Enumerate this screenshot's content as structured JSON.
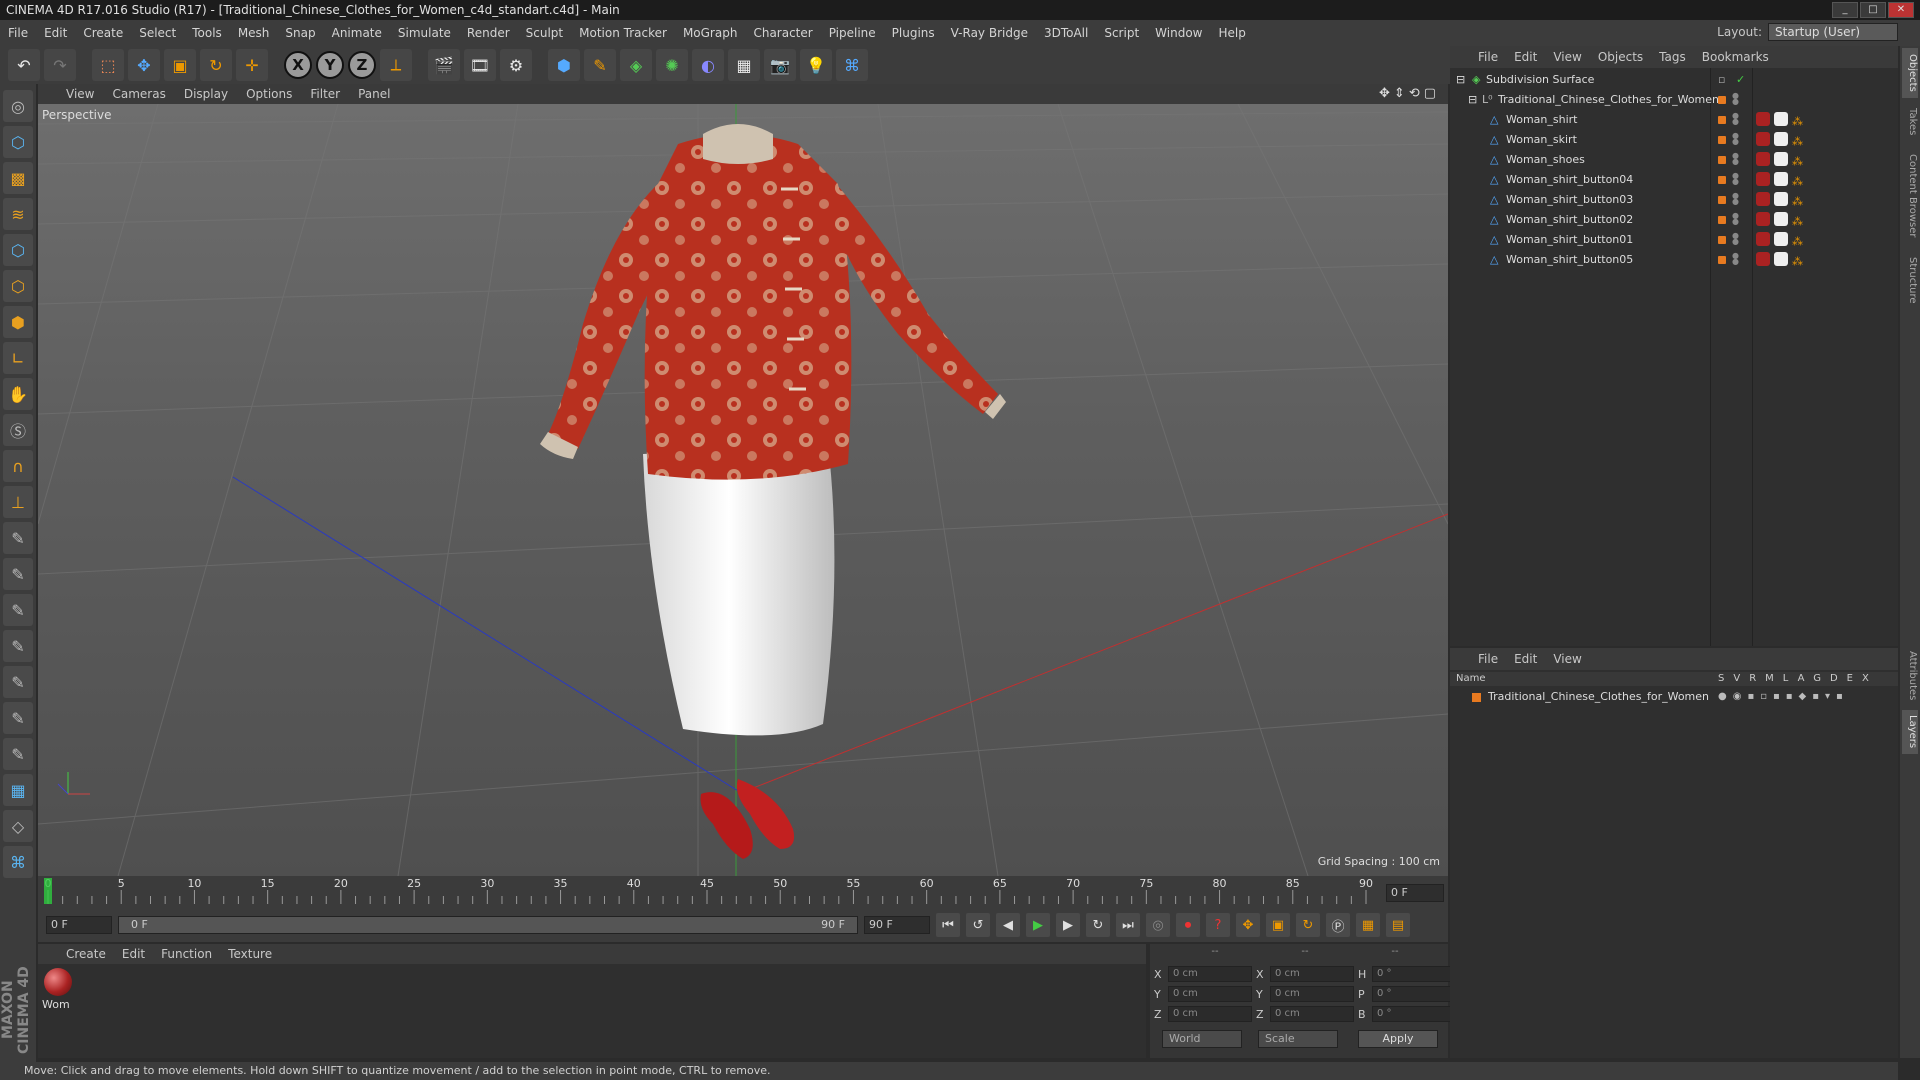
{
  "window": {
    "title": "CINEMA 4D R17.016 Studio (R17) - [Traditional_Chinese_Clothes_for_Women_c4d_standart.c4d] - Main"
  },
  "menubar": [
    "File",
    "Edit",
    "Create",
    "Select",
    "Tools",
    "Mesh",
    "Snap",
    "Animate",
    "Simulate",
    "Render",
    "Sculpt",
    "Motion Tracker",
    "MoGraph",
    "Character",
    "Pipeline",
    "Plugins",
    "V-Ray Bridge",
    "3DToAll",
    "Script",
    "Window",
    "Help"
  ],
  "layout": {
    "label": "Layout:",
    "value": "Startup (User)"
  },
  "toolbar": {
    "axis_x": "X",
    "axis_y": "Y",
    "axis_z": "Z"
  },
  "viewport": {
    "menu": [
      "View",
      "Cameras",
      "Display",
      "Options",
      "Filter",
      "Panel"
    ],
    "label": "Perspective",
    "grid_spacing": "Grid Spacing : 100 cm"
  },
  "timeline": {
    "ticks": [
      "0",
      "5",
      "10",
      "15",
      "20",
      "25",
      "30",
      "35",
      "40",
      "45",
      "50",
      "55",
      "60",
      "65",
      "70",
      "75",
      "80",
      "85",
      "90"
    ],
    "current_frame": "0 F",
    "start_field": "0 F",
    "range_start": "0 F",
    "range_end": "90 F",
    "end_field": "90 F"
  },
  "material_manager": {
    "menu": [
      "Create",
      "Edit",
      "Function",
      "Texture"
    ],
    "material_name": "Wom"
  },
  "coords": {
    "headers": [
      "--",
      "--",
      "--"
    ],
    "rows": [
      {
        "l1": "X",
        "v1": "0 cm",
        "l2": "X",
        "v2": "0 cm",
        "l3": "H",
        "v3": "0 °"
      },
      {
        "l1": "Y",
        "v1": "0 cm",
        "l2": "Y",
        "v2": "0 cm",
        "l3": "P",
        "v3": "0 °"
      },
      {
        "l1": "Z",
        "v1": "0 cm",
        "l2": "Z",
        "v2": "0 cm",
        "l3": "B",
        "v3": "0 °"
      }
    ],
    "world": "World",
    "scale": "Scale",
    "apply": "Apply"
  },
  "status": "Move: Click and drag to move elements. Hold down SHIFT to quantize movement / add to the selection in point mode, CTRL to remove.",
  "object_manager": {
    "menu": [
      "File",
      "Edit",
      "View",
      "Objects",
      "Tags",
      "Bookmarks"
    ],
    "objects": [
      {
        "name": "Subdivision Surface"
      },
      {
        "name": "Traditional_Chinese_Clothes_for_Women"
      },
      {
        "name": "Woman_shirt"
      },
      {
        "name": "Woman_skirt"
      },
      {
        "name": "Woman_shoes"
      },
      {
        "name": "Woman_shirt_button04"
      },
      {
        "name": "Woman_shirt_button03"
      },
      {
        "name": "Woman_shirt_button02"
      },
      {
        "name": "Woman_shirt_button01"
      },
      {
        "name": "Woman_shirt_button05"
      }
    ]
  },
  "layer_manager": {
    "menu": [
      "File",
      "Edit",
      "View"
    ],
    "header_name": "Name",
    "header_cols": "SVRMLAGDEX",
    "layer": "Traditional_Chinese_Clothes_for_Women"
  },
  "right_tabs": [
    "Objects",
    "Takes",
    "Content Browser",
    "Structure",
    "Attributes",
    "Layers"
  ],
  "colors": {
    "accent": "#e87a20",
    "background": "#2b2b2b",
    "panel": "#3c3c3c"
  }
}
